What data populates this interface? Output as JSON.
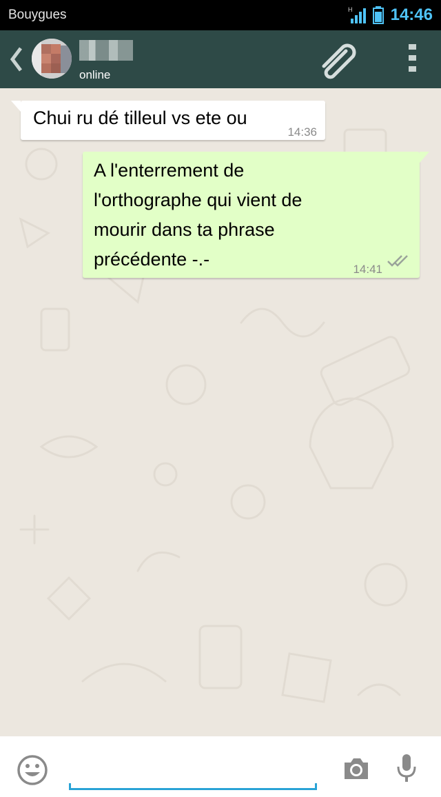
{
  "status_bar": {
    "carrier": "Bouygues",
    "network_type": "H",
    "time": "14:46",
    "icons": [
      "signal-icon",
      "battery-icon"
    ]
  },
  "header": {
    "contact_name": "",
    "contact_status": "online",
    "icons": [
      "back-arrow-icon",
      "avatar",
      "paperclip-icon",
      "overflow-menu-icon"
    ]
  },
  "messages": [
    {
      "direction": "incoming",
      "lines": [
        "Chui ru dé tilleul vs ete ou"
      ],
      "time": "14:36"
    },
    {
      "direction": "outgoing",
      "lines": [
        "A l'enterrement de",
        "l'orthographe qui vient de",
        "mourir dans ta phrase",
        "précédente -.-"
      ],
      "time": "14:41",
      "status_icon": "double-check-icon"
    }
  ],
  "input_bar": {
    "placeholder": "",
    "value": "",
    "icons": [
      "emoji-icon",
      "camera-icon",
      "microphone-icon"
    ]
  },
  "colors": {
    "header_bg": "#2e4a47",
    "status_time": "#4fc3f7",
    "outgoing_bubble": "#e2ffc7",
    "incoming_bubble": "#ffffff",
    "chat_bg": "#ece7df",
    "input_underline": "#29a3d6"
  }
}
